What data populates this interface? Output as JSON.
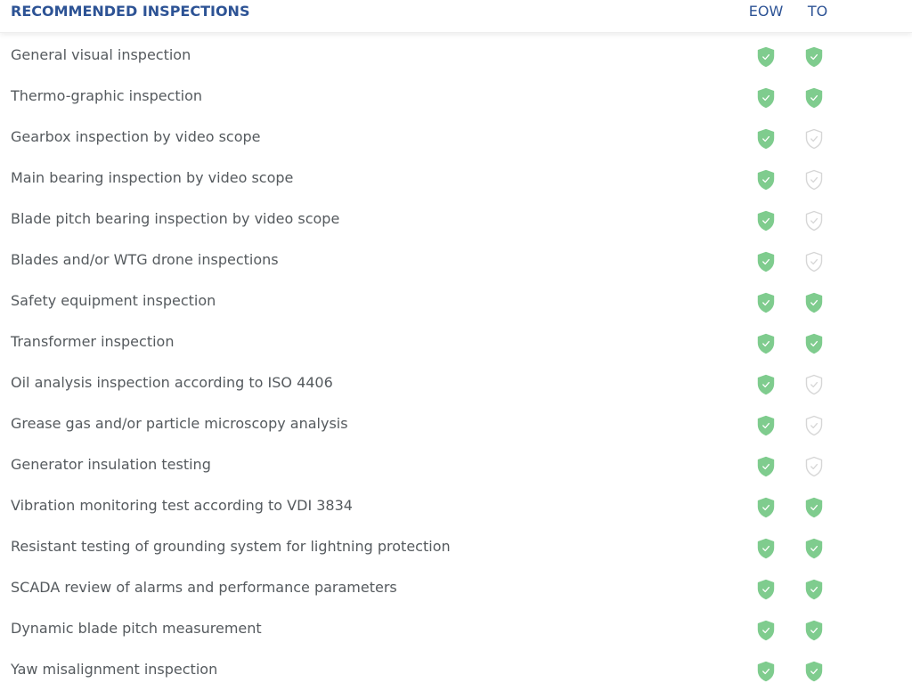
{
  "header": {
    "title": "RECOMMENDED INSPECTIONS",
    "columns": [
      "EOW",
      "TO"
    ]
  },
  "colors": {
    "title": "#2d5395",
    "text": "#555a5e",
    "shield_active": "#7fcc8e",
    "shield_inactive": "#d6d6d6"
  },
  "icons": {
    "active": "shield-check-icon",
    "inactive": "shield-check-outline-icon"
  },
  "rows": [
    {
      "label": "General visual inspection",
      "eow": true,
      "to": true
    },
    {
      "label": "Thermo-graphic inspection",
      "eow": true,
      "to": true
    },
    {
      "label": "Gearbox inspection by video scope",
      "eow": true,
      "to": false
    },
    {
      "label": "Main bearing inspection by video scope",
      "eow": true,
      "to": false
    },
    {
      "label": "Blade pitch bearing inspection by video scope",
      "eow": true,
      "to": false
    },
    {
      "label": "Blades and/or WTG drone inspections",
      "eow": true,
      "to": false
    },
    {
      "label": "Safety equipment inspection",
      "eow": true,
      "to": true
    },
    {
      "label": "Transformer inspection",
      "eow": true,
      "to": true
    },
    {
      "label": "Oil analysis inspection according to ISO 4406",
      "eow": true,
      "to": false
    },
    {
      "label": "Grease gas and/or particle microscopy analysis",
      "eow": true,
      "to": false
    },
    {
      "label": "Generator insulation testing",
      "eow": true,
      "to": false
    },
    {
      "label": "Vibration monitoring test according to VDI 3834",
      "eow": true,
      "to": true
    },
    {
      "label": "Resistant testing of grounding system for lightning protection",
      "eow": true,
      "to": true
    },
    {
      "label": "SCADA review of alarms and performance parameters",
      "eow": true,
      "to": true
    },
    {
      "label": "Dynamic blade pitch measurement",
      "eow": true,
      "to": true
    },
    {
      "label": "Yaw misalignment inspection",
      "eow": true,
      "to": true
    }
  ]
}
